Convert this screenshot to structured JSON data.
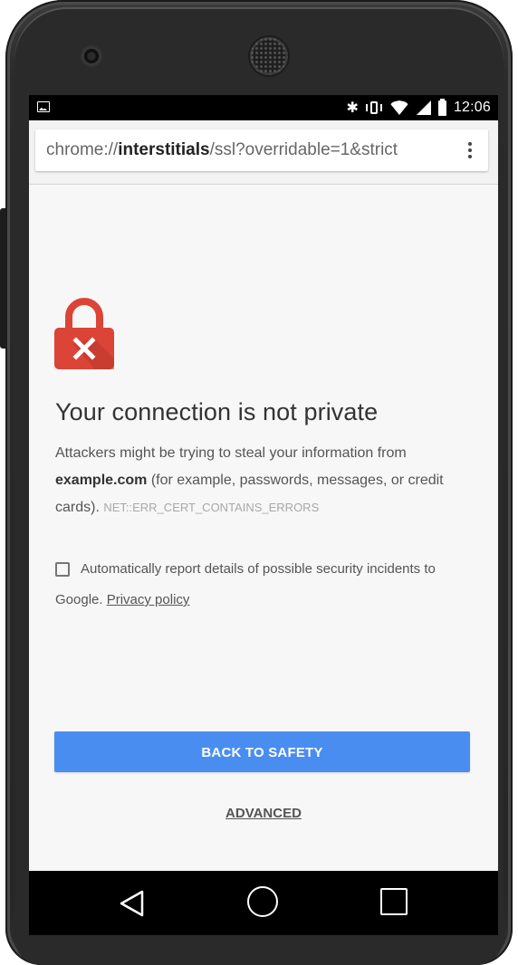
{
  "status_bar": {
    "time": "12:06",
    "icons": [
      "gallery-icon",
      "bluetooth-icon",
      "vibrate-icon",
      "wifi-icon",
      "signal-icon",
      "battery-icon"
    ],
    "bluetooth_glyph": "✱"
  },
  "toolbar": {
    "url_scheme": "chrome://",
    "url_host": "interstitials",
    "url_path": "/ssl?overridable=1&strict",
    "menu_icon": "more-vert-icon"
  },
  "interstitial": {
    "icon": "lock-error-icon",
    "heading": "Your connection is not private",
    "body_prefix": "Attackers might be trying to steal your information from ",
    "host": "example.com",
    "body_suffix": " (for example, passwords, messages, or credit cards). ",
    "error_code": "NET::ERR_CERT_CONTAINS_ERRORS",
    "report_text": "Automatically report details of possible security incidents to Google. ",
    "privacy_link": "Privacy policy",
    "report_checked": false,
    "primary_button": "BACK TO SAFETY",
    "advanced_link": "ADVANCED"
  },
  "colors": {
    "accent_blue": "#4a8df1",
    "lock_red": "#db4437",
    "lock_shadow": "#b63a2e"
  },
  "nav_bar": {
    "back_icon": "back-triangle-icon",
    "home_icon": "home-circle-icon",
    "recents_icon": "recents-square-icon"
  }
}
